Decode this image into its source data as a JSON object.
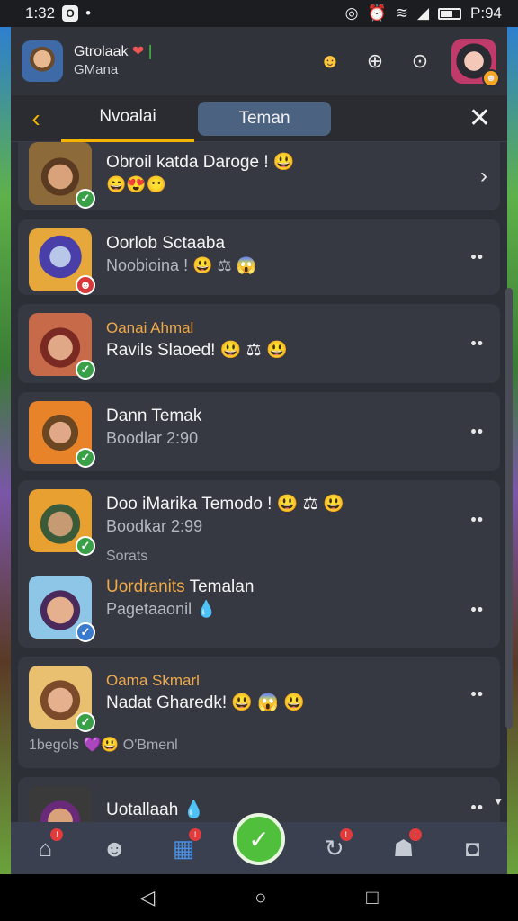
{
  "status_bar": {
    "time": "1:32",
    "right_time": "P:94"
  },
  "header": {
    "user_name": "Gtrolaak",
    "user_sub": "GMana",
    "icons": [
      "smile-icon",
      "globe-icon",
      "circle-icon"
    ]
  },
  "tabs": {
    "tab1": "Nvoalai",
    "tab2": "Teman"
  },
  "chats": [
    {
      "tag": "",
      "title": "Obroil katda Daroge ! 😃",
      "line2": "😄😍😶",
      "extra": ""
    },
    {
      "tag": "",
      "title": "Oorlob Sctaaba",
      "line2": "Noobioina ! 😃 ⚖ 😱",
      "extra": ""
    },
    {
      "tag": "Oanai Ahmal",
      "title": "Ravils Slaoed! 😃 ⚖ 😃",
      "line2": "",
      "extra": ""
    },
    {
      "tag": "",
      "title": "Dann Temak",
      "line2": "Boodlar 2:90",
      "extra": ""
    },
    {
      "tag": "",
      "title": "Doo iMarika Temodo ! 😃 ⚖ 😃",
      "line2": "Boodkar 2:99",
      "extra": "Sorats"
    },
    {
      "tag": "Uordranits",
      "title": "Temalan",
      "line2": "Pagetaaonil 💧",
      "extra": ""
    },
    {
      "tag": "Oama Skmarl",
      "title": "Nadat Gharedk! 😃 😱 😃",
      "line2": "",
      "extra": "1begols 💜😃 O'Bmenl"
    },
    {
      "tag": "",
      "title": "Uotallaah 💧",
      "line2": "",
      "extra": ""
    }
  ],
  "colors": {
    "accent": "#f5b400",
    "tag": "#f0a94a",
    "nav": "#3a4050",
    "check": "#3aa048"
  }
}
